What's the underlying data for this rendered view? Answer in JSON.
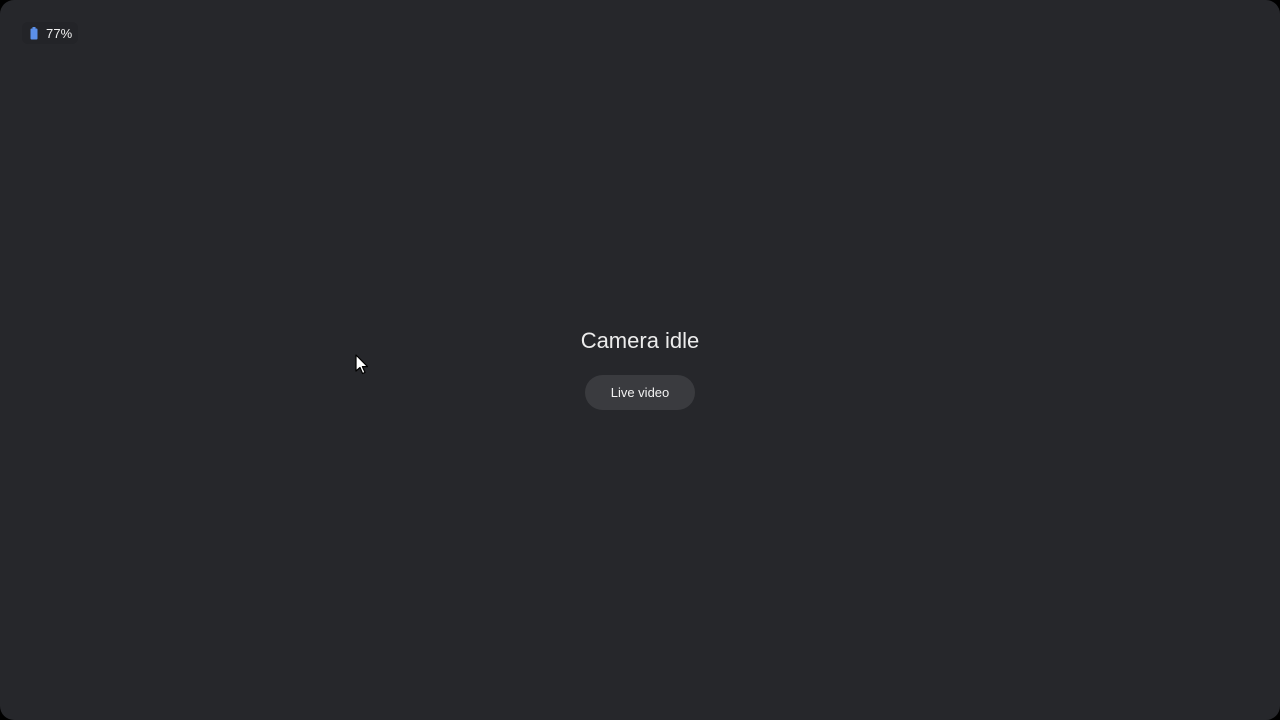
{
  "status_bar": {
    "battery_icon": "battery-icon",
    "battery_level": 0.77,
    "battery_text": "77%",
    "battery_color": "#5b8fe8"
  },
  "main": {
    "title": "Camera idle",
    "live_button_label": "Live video"
  },
  "colors": {
    "background": "#26272b",
    "button_bg": "#3a3b3f",
    "text": "#ececec"
  }
}
